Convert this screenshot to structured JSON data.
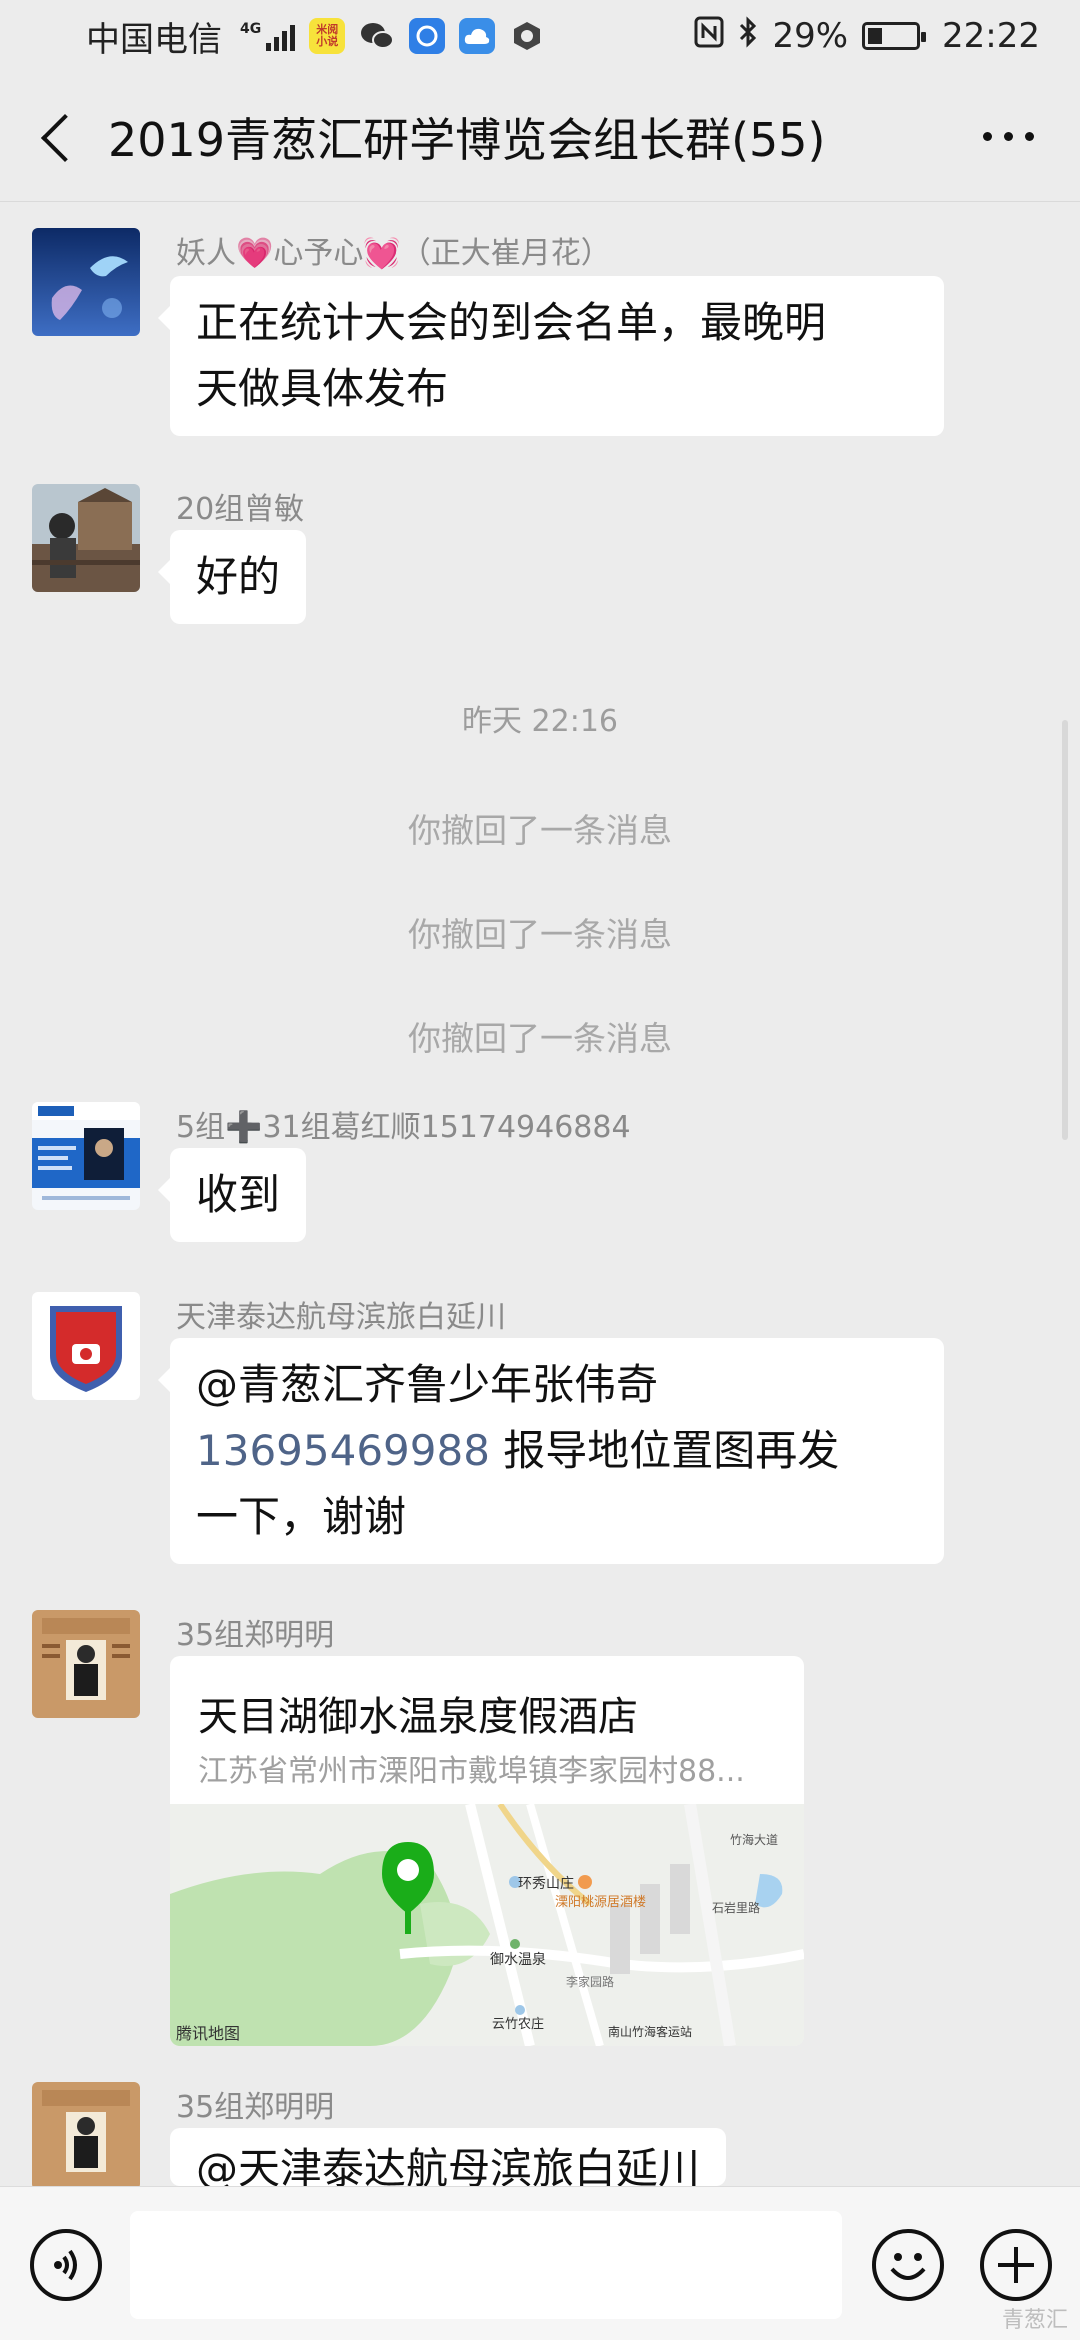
{
  "status_bar": {
    "carrier": "中国电信",
    "network": "4G",
    "app_badge": "米阅小说",
    "battery": "29%",
    "time": "22:22"
  },
  "header": {
    "title": "2019青葱汇研学博览会组长群(55)"
  },
  "messages": [
    {
      "sender": "妖人💗心予心💓（正大崔月花）",
      "text_lines": [
        "正在统计大会的到会名单，最晚明",
        "天做具体发布"
      ]
    },
    {
      "sender": "20组曾敏",
      "text_lines": [
        "好的"
      ]
    }
  ],
  "timestamp": "昨天 22:16",
  "recalled": [
    "你撤回了一条消息",
    "你撤回了一条消息",
    "你撤回了一条消息"
  ],
  "messages2": [
    {
      "sender": "5组➕31组葛红顺15174946884",
      "text_lines": [
        "收到"
      ]
    },
    {
      "sender": "天津泰达航母滨旅白延川",
      "line1": "@青葱汇齐鲁少年张伟奇",
      "phone": "13695469988",
      "line2_rest": " 报导地位置图再发",
      "line3": "一下，谢谢"
    }
  ],
  "location_msg": {
    "sender": "35组郑明明",
    "title": "天目湖御水温泉度假酒店",
    "address": "江苏省常州市溧阳市戴埠镇李家园村88...",
    "map_labels": [
      "环秀山庄",
      "溧阳桃源居酒楼",
      "御水温泉",
      "云竹农庄",
      "李家园路",
      "南山竹海客运站",
      "石岩里路",
      "竹海大道",
      "腾讯地图"
    ]
  },
  "last_msg": {
    "sender": "35组郑明明",
    "partial": "@天津泰达航母滨旅白延川"
  },
  "input": {
    "placeholder": ""
  },
  "watermark": "青葱汇",
  "colors": {
    "background": "#ececec",
    "bubble": "#ffffff",
    "link": "#4f6488",
    "pin": "#1aad19"
  }
}
